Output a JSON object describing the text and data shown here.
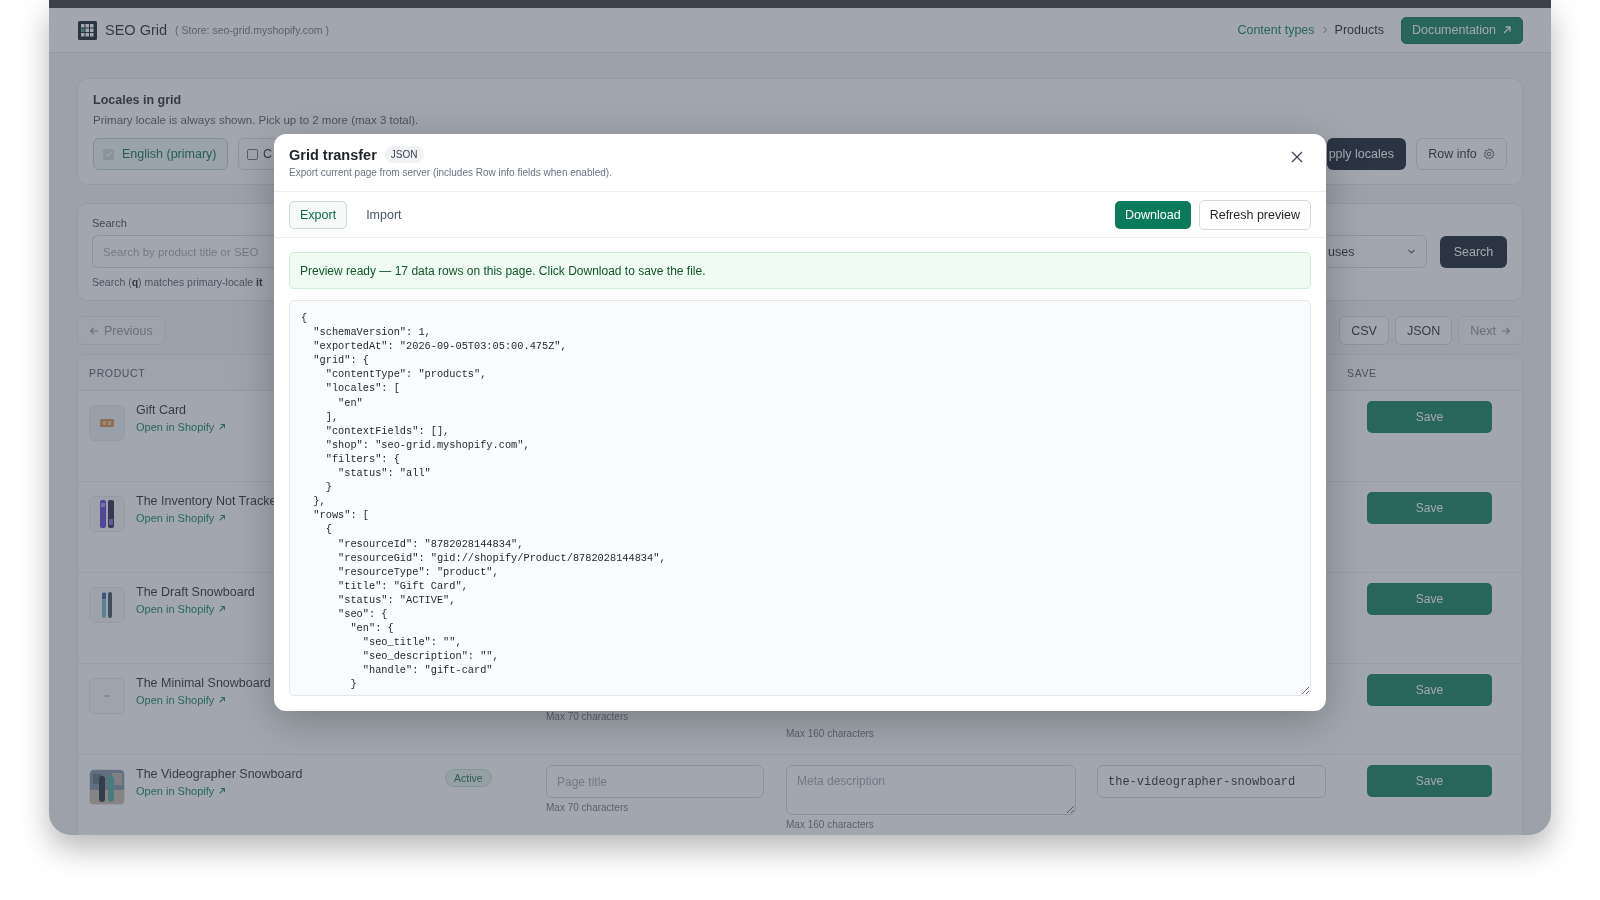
{
  "app": {
    "name": "SEO Grid",
    "store": "( Store: seo-grid.myshopify.com )"
  },
  "breadcrumb": [
    {
      "label": "Content types",
      "kind": "link"
    },
    {
      "label": "Products",
      "kind": "current"
    }
  ],
  "documentation_button": "Documentation",
  "locales_panel": {
    "title": "Locales in grid",
    "description": "Primary locale is always shown. Pick up to 2 more (max 3 total).",
    "locales": [
      {
        "label": "English (primary)",
        "checked": true,
        "disabled": true
      },
      {
        "label": "C",
        "checked": false,
        "disabled": false
      }
    ],
    "apply_button": "pply locales",
    "row_info_button": "Row info"
  },
  "search_panel": {
    "label": "Search",
    "placeholder": "Search by product title or SEO",
    "status_filter": "uses",
    "search_button": "Search",
    "hint": "Search (**q**) matches primary-locale **it**"
  },
  "pagination": {
    "previous": {
      "label": "Previous",
      "disabled": true
    },
    "formats": [
      "CSV",
      "JSON"
    ],
    "next": {
      "label": "Next",
      "disabled": true
    }
  },
  "table": {
    "columns": {
      "product": "PRODUCT",
      "save": "SAVE"
    },
    "rows": [
      {
        "title": "Gift Card",
        "link": "Open in Shopify",
        "save": "Save"
      },
      {
        "title": "The Inventory Not Tracke",
        "link": "Open in Shopify",
        "save": "Save"
      },
      {
        "title": "The Draft Snowboard",
        "link": "Open in Shopify",
        "save": "Save"
      },
      {
        "title": "The Minimal Snowboard",
        "link": "Open in Shopify",
        "thumbnail": {
          "kind": "placeholder"
        },
        "page_title": {
          "hint": "Max 70 characters"
        },
        "meta_description": {
          "hint": "Max 160 characters"
        },
        "save": "Save"
      },
      {
        "title": "The Videographer Snowboard",
        "link": "Open in Shopify",
        "status": "Active",
        "page_title": {
          "placeholder": "Page title",
          "hint": "Max 70 characters"
        },
        "meta_description": {
          "placeholder": "Meta description",
          "hint": "Max 160 characters"
        },
        "handle": {
          "value": "the-videographer-snowboard"
        },
        "save": "Save"
      }
    ]
  },
  "modal": {
    "title": "Grid transfer",
    "format_badge": "JSON",
    "subtitle": "Export current page from server (includes Row info fields when enabled).",
    "tabs": [
      {
        "label": "Export",
        "selected": true
      },
      {
        "label": "Import",
        "selected": false
      }
    ],
    "download_button": "Download",
    "refresh_button": "Refresh preview",
    "alert": "Preview ready — 17 data rows on this page. Click Download to save the file.",
    "preview": "{\n  \"schemaVersion\": 1,\n  \"exportedAt\": \"2026-09-05T03:05:00.475Z\",\n  \"grid\": {\n    \"contentType\": \"products\",\n    \"locales\": [\n      \"en\"\n    ],\n    \"contextFields\": [],\n    \"shop\": \"seo-grid.myshopify.com\",\n    \"filters\": {\n      \"status\": \"all\"\n    }\n  },\n  \"rows\": [\n    {\n      \"resourceId\": \"8782028144834\",\n      \"resourceGid\": \"gid://shopify/Product/8782028144834\",\n      \"resourceType\": \"product\",\n      \"title\": \"Gift Card\",\n      \"status\": \"ACTIVE\",\n      \"seo\": {\n        \"en\": {\n          \"seo_title\": \"\",\n          \"seo_description\": \"\",\n          \"handle\": \"gift-card\"\n        }"
  }
}
